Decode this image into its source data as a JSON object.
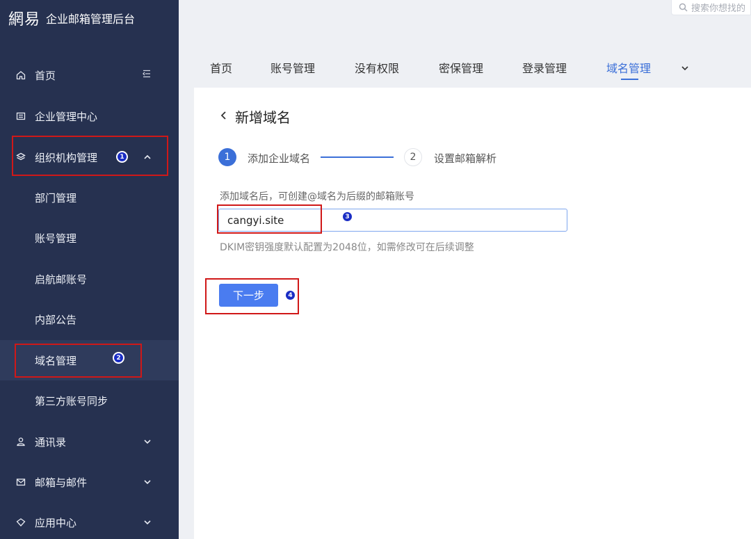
{
  "brand": {
    "logo": "網易",
    "title": "企业邮箱管理后台"
  },
  "search": {
    "placeholder": "搜索你想找的"
  },
  "sidebar": {
    "items": [
      {
        "label": "首页",
        "icon": "home-icon"
      },
      {
        "label": "企业管理中心",
        "icon": "building-icon"
      },
      {
        "label": "组织机构管理",
        "icon": "layers-icon"
      },
      {
        "label": "部门管理"
      },
      {
        "label": "账号管理"
      },
      {
        "label": "启航邮账号"
      },
      {
        "label": "内部公告"
      },
      {
        "label": "域名管理"
      },
      {
        "label": "第三方账号同步"
      },
      {
        "label": "通讯录",
        "icon": "user-icon"
      },
      {
        "label": "邮箱与邮件",
        "icon": "mail-icon"
      },
      {
        "label": "应用中心",
        "icon": "app-icon"
      }
    ]
  },
  "tabs": [
    "首页",
    "账号管理",
    "没有权限",
    "密保管理",
    "登录管理",
    "域名管理"
  ],
  "active_tab": "域名管理",
  "page": {
    "title": "新增域名",
    "steps": [
      {
        "num": "1",
        "label": "添加企业域名"
      },
      {
        "num": "2",
        "label": "设置邮箱解析"
      }
    ],
    "hint": "添加域名后，可创建@域名为后缀的邮箱账号",
    "domain_value": "cangyi.site",
    "dkim_note": "DKIM密钥强度默认配置为2048位，如需修改可在后续调整",
    "next_label": "下一步"
  },
  "annotations": [
    "1",
    "2",
    "3",
    "4"
  ],
  "colors": {
    "sidebar_bg": "#263150",
    "accent": "#3b6fd8",
    "button": "#4a7cf0",
    "highlight": "#d01818"
  }
}
